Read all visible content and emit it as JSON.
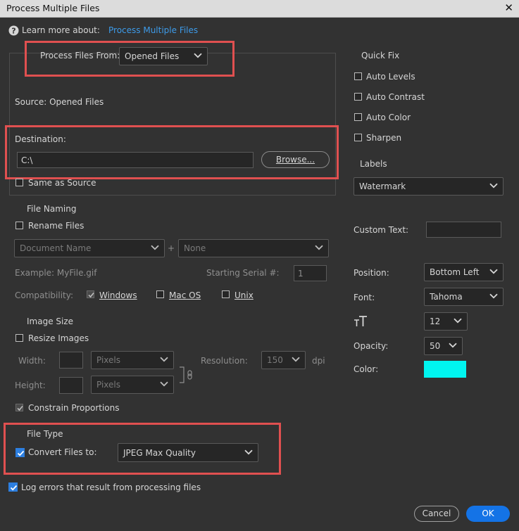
{
  "window": {
    "title": "Process Multiple Files"
  },
  "help": {
    "learn_more": "Learn more about:",
    "link": "Process Multiple Files"
  },
  "source": {
    "process_from_label": "Process Files From:",
    "process_from_value": "Opened Files",
    "source_text": "Source: Opened Files"
  },
  "destination": {
    "label": "Destination:",
    "path": "C:\\",
    "browse": "Browse...",
    "same_as_source": "Same as Source"
  },
  "file_naming": {
    "title": "File Naming",
    "rename": "Rename Files",
    "first": "Document Name",
    "plus": "+",
    "second": "None",
    "example": "Example: MyFile.gif",
    "serial_label": "Starting Serial #:",
    "serial_value": "1",
    "compat_label": "Compatibility:",
    "windows": "Windows",
    "macos": "Mac OS",
    "unix": "Unix"
  },
  "image_size": {
    "title": "Image Size",
    "resize": "Resize Images",
    "width_label": "Width:",
    "height_label": "Height:",
    "width_unit": "Pixels",
    "height_unit": "Pixels",
    "resolution_label": "Resolution:",
    "resolution_value": "150",
    "dpi": "dpi",
    "constrain": "Constrain Proportions"
  },
  "file_type": {
    "title": "File Type",
    "convert": "Convert Files to:",
    "format": "JPEG Max Quality"
  },
  "log_errors": "Log errors that result from processing files",
  "quick_fix": {
    "title": "Quick Fix",
    "items": [
      "Auto Levels",
      "Auto Contrast",
      "Auto Color",
      "Sharpen"
    ]
  },
  "labels": {
    "title": "Labels",
    "type": "Watermark",
    "custom_text_label": "Custom Text:",
    "position_label": "Position:",
    "position_value": "Bottom Left",
    "font_label": "Font:",
    "font_value": "Tahoma",
    "size_value": "12",
    "opacity_label": "Opacity:",
    "opacity_value": "50",
    "color_label": "Color:",
    "color_hex": "#00f5f0"
  },
  "buttons": {
    "cancel": "Cancel",
    "ok": "OK"
  },
  "colors": {
    "accent": "#1473e6",
    "highlight": "#e05050",
    "checkbox": "#2d7fe0"
  },
  "icons": [
    "help-icon",
    "close-icon",
    "chevron-down-icon",
    "link-chain-icon",
    "text-size-icon",
    "checkmark-icon"
  ]
}
